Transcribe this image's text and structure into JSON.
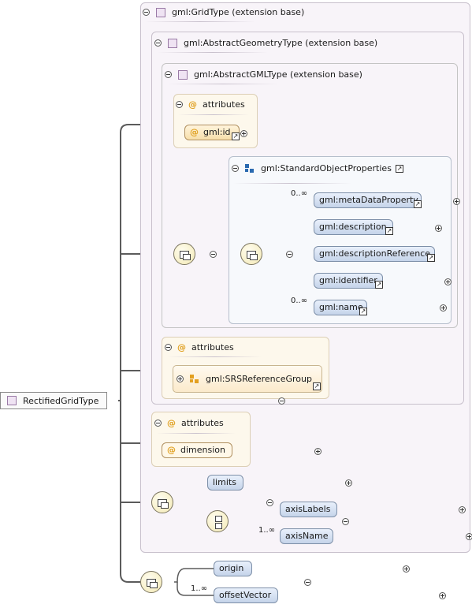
{
  "root": {
    "label": "RectifiedGridType"
  },
  "frames": {
    "grid_type": "gml:GridType (extension base)",
    "abstract_geometry_type": "gml:AbstractGeometryType (extension base)",
    "abstract_gml_type": "gml:AbstractGMLType (extension base)"
  },
  "attributes_label": "attributes",
  "attr_gml_id": "gml:id",
  "standard_object_properties": {
    "label": "gml:StandardObjectProperties",
    "elements": [
      {
        "label": "gml:metaDataProperty",
        "card": "0..∞"
      },
      {
        "label": "gml:description",
        "card": ""
      },
      {
        "label": "gml:descriptionReference",
        "card": ""
      },
      {
        "label": "gml:identifier",
        "card": ""
      },
      {
        "label": "gml:name",
        "card": "0..∞"
      }
    ]
  },
  "srs_reference_group": "gml:SRSReferenceGroup",
  "attr_dimension": "dimension",
  "grid_elements": {
    "limits": "limits",
    "axis_labels": "axisLabels",
    "axis_name": {
      "label": "axisName",
      "card": "1..∞"
    }
  },
  "rectified_elements": {
    "origin": "origin",
    "offset_vector": {
      "label": "offsetVector",
      "card": "1..∞"
    }
  },
  "icons": [
    "type-square-icon",
    "attribute-at-icon",
    "group-icon",
    "attribute-group-icon",
    "sequence-compositor-icon",
    "choice-compositor-icon",
    "collapse-toggle-icon",
    "expand-toggle-icon",
    "link-arrow-icon"
  ],
  "colors": {
    "frame_bg": "#f8f4f9",
    "element_fill": "#c5d4ea",
    "attribute_fill": "#f7dfaa",
    "compositor_fill": "#f3e9b4"
  }
}
